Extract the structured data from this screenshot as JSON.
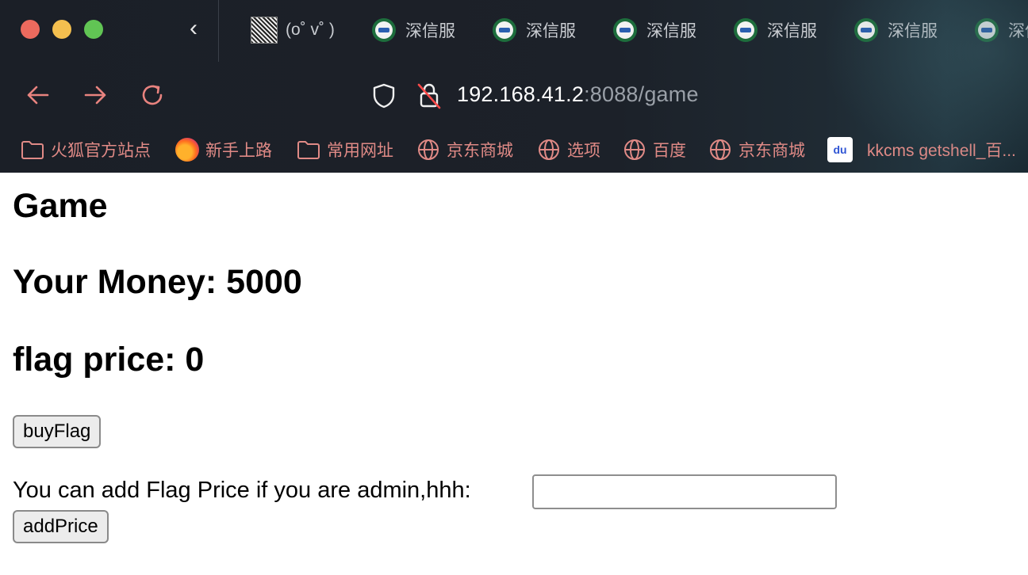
{
  "browser": {
    "tabs": [
      {
        "label": "(o˚ v˚ )",
        "favicon": "qr-code-favicon"
      },
      {
        "label": "深信服",
        "favicon": "seal-favicon"
      },
      {
        "label": "深信服",
        "favicon": "seal-favicon"
      },
      {
        "label": "深信服",
        "favicon": "seal-favicon"
      },
      {
        "label": "深信服",
        "favicon": "seal-favicon"
      },
      {
        "label": "深信服",
        "favicon": "seal-favicon"
      },
      {
        "label": "深信",
        "favicon": "seal-favicon"
      }
    ],
    "url": {
      "host": "192.168.41.2",
      "rest": ":8088/game"
    },
    "bookmarks": [
      {
        "label": "火狐官方站点",
        "icon": "folder-icon"
      },
      {
        "label": "新手上路",
        "icon": "firefox-icon"
      },
      {
        "label": "常用网址",
        "icon": "folder-icon"
      },
      {
        "label": "京东商城",
        "icon": "globe-icon"
      },
      {
        "label": "选项",
        "icon": "globe-icon"
      },
      {
        "label": "百度",
        "icon": "globe-icon"
      },
      {
        "label": "京东商城",
        "icon": "globe-icon"
      },
      {
        "label": "kkcms getshell_百...",
        "icon": "baidu-icon"
      }
    ],
    "colors": {
      "accent": "#e8837f",
      "chrome_bg": "#1b1f27"
    }
  },
  "page": {
    "title": "Game",
    "money": "Your Money: 5000",
    "flag_price": "flag price: 0",
    "buy_button": "buyFlag",
    "add_label": "You can add Flag Price if you are admin,hhh:",
    "add_input_value": "",
    "add_button": "addPrice"
  }
}
